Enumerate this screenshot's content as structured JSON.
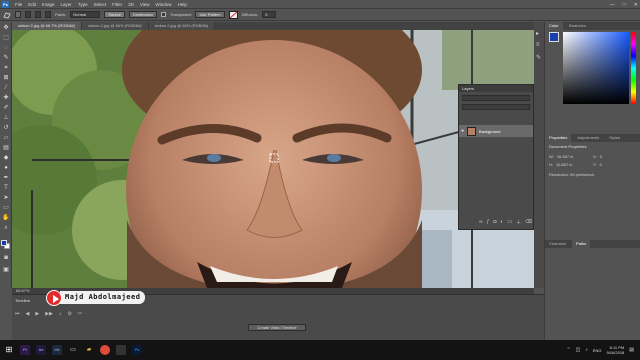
{
  "menu": {
    "logo": "Ps",
    "items": [
      "File",
      "Edit",
      "Image",
      "Layer",
      "Type",
      "Select",
      "Filter",
      "3D",
      "View",
      "Window",
      "Help"
    ],
    "window_controls": [
      "—",
      "□",
      "✕"
    ]
  },
  "options_bar": {
    "patch_label": "Patch:",
    "patch_mode": "Normal",
    "source_label": "Source",
    "destination_label": "Destination",
    "transparent_label": "Transparent",
    "use_pattern_label": "Use Pattern",
    "diffusion_label": "Diffusion:",
    "diffusion_value": "5"
  },
  "tabs": [
    "sinkon 2.jpg @ 66.7% (RGB/8#)",
    "sinkon 2.jpg @ 66% (RGB/8#)",
    "sinkon 2.jpg @ 66% (RGB/8#)"
  ],
  "right_panel": {
    "color_tabs": [
      "Color",
      "Swatches"
    ],
    "props_tabs": [
      "Properties",
      "Adjustments",
      "Styles"
    ],
    "props_title": "Document Properties",
    "w_label": "W:",
    "w_value": "16.667 in",
    "h_label": "H:",
    "h_value": "16.667 in",
    "x_label": "X:",
    "x_value": "0",
    "y_label": "Y:",
    "y_value": "0",
    "resolution": "Resolution: 96 pixels/inch",
    "bottom_tabs": [
      "Channels",
      "Paths"
    ]
  },
  "layers_panel": {
    "title": "Layers",
    "layer_name": "Background"
  },
  "status": {
    "zoom": "66.67%"
  },
  "timeline": {
    "title": "Timeline",
    "create_button": "Create Video Timeline"
  },
  "watermark": {
    "text": "Majd Abdolmajeed"
  },
  "taskbar": {
    "language": "ENG",
    "time": "8:11 PM",
    "date": "9/16/2018"
  },
  "colors": {
    "ui_bg": "#535353",
    "accent": "#2a6fb8",
    "youtube_red": "#e32b2b"
  }
}
